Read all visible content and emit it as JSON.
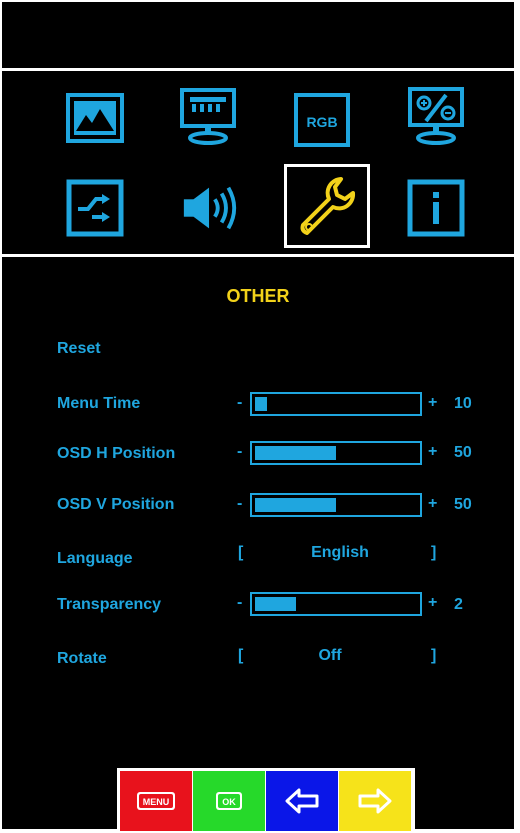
{
  "menu": {
    "title": "OTHER",
    "items": [
      {
        "label": "Reset"
      },
      {
        "label": "Menu Time",
        "value": "10",
        "level": 0.02
      },
      {
        "label": "OSD H Position",
        "value": "50",
        "level": 0.5
      },
      {
        "label": "OSD V Position",
        "value": "50",
        "level": 0.5
      },
      {
        "label": "Language",
        "option": "English"
      },
      {
        "label": "Transparency",
        "value": "2",
        "level": 0.25
      },
      {
        "label": "Rotate",
        "option": "Off"
      }
    ]
  },
  "slider_symbols": {
    "minus": "-",
    "plus": "+",
    "open": "[",
    "close": "]"
  },
  "icons": [
    "picture-icon",
    "display-icon",
    "rgb-icon",
    "adjust-icon",
    "input-icon",
    "audio-icon",
    "wrench-icon",
    "info-icon"
  ],
  "icon_text": {
    "rgb": "RGB"
  },
  "buttons": [
    {
      "label": "MENU",
      "color": "#e8121c"
    },
    {
      "label": "OK",
      "color": "#26d92a"
    },
    {
      "icon": "left-arrow-icon",
      "color": "#0a16e8"
    },
    {
      "icon": "right-arrow-icon",
      "color": "#f6e31a"
    }
  ],
  "colors": {
    "accent": "#1fa6df",
    "title": "#f2d21a",
    "background": "#000000"
  }
}
